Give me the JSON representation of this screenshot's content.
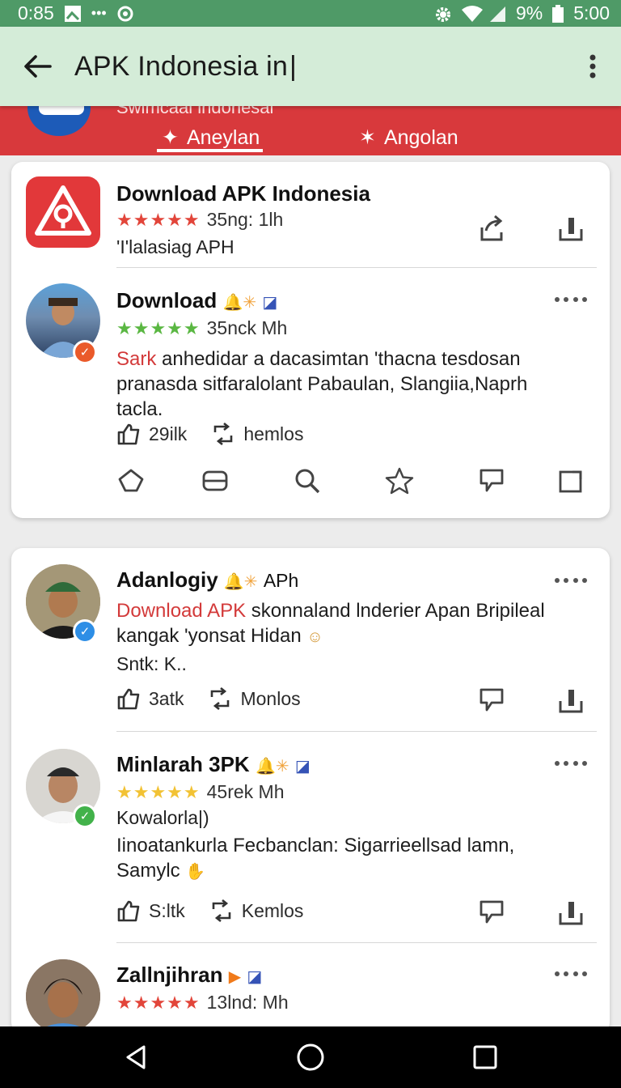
{
  "status_bar": {
    "time": "0:85",
    "battery": "9%",
    "clock_right": "5:00"
  },
  "app_bar": {
    "search_query": "APK Indonesia in"
  },
  "header": {
    "subtitle": "Swimcaai indonesai",
    "tabs": [
      {
        "label": "Aneylan",
        "active": true
      },
      {
        "label": "Angolan",
        "active": false
      }
    ],
    "colors": {
      "red": "#d8393c",
      "appbar": "#d4ecd8",
      "status": "#4f9a67"
    }
  },
  "app_listing": {
    "title": "Download APK Indonesia",
    "rating_text": "35ng: 1lh",
    "stars": 5,
    "subtitle": "'I'lalasiag APH"
  },
  "posts": [
    {
      "name": "Download",
      "stars": 5,
      "rating_text": "35nck Mh",
      "highlight": "Sark",
      "text": " anhedidar a dacasimtan 'thacna tesdosan pranasda sitfaralolant Pabaulan, Slangiia,Naprh tacla.",
      "likes": "29ilk",
      "reposts": "hemlos",
      "badge_color": "#ea5a2a"
    },
    {
      "name": "Adanlogiy",
      "tag": "APh",
      "highlight": "Download APK",
      "text": " skonnaland lnderier Apan Bripileal kangak 'yonsat Hidan",
      "extra": "Sntk: K..",
      "likes": "3atk",
      "reposts": "Monlos",
      "badge_color": "#2d8ee6"
    },
    {
      "name": "Minlarah 3PK",
      "stars": 5,
      "rating_text": "45rek Mh",
      "handle": "Kowalorla|)",
      "text": "Iinoatankurla Fecbanclan: Sigarrieellsad lamn, Samylc",
      "likes": "S:ltk",
      "reposts": "Kemlos",
      "badge_color": "#42b24a"
    },
    {
      "name": "Zallnjihran",
      "stars": 5,
      "rating_text": "13lnd: Mh"
    }
  ]
}
